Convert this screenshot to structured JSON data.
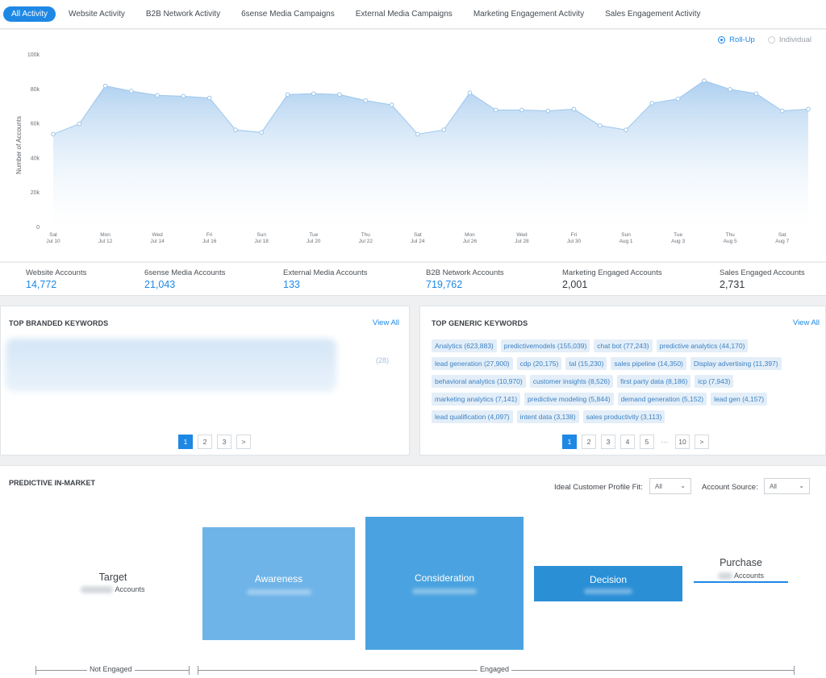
{
  "tabs": [
    {
      "label": "All Activity",
      "active": true
    },
    {
      "label": "Website Activity"
    },
    {
      "label": "B2B Network Activity"
    },
    {
      "label": "6sense Media Campaigns"
    },
    {
      "label": "External Media Campaigns"
    },
    {
      "label": "Marketing Engagement Activity"
    },
    {
      "label": "Sales Engagement Activity"
    }
  ],
  "view_toggle": {
    "rollup": {
      "label": "Roll-Up",
      "checked": true
    },
    "individual": {
      "label": "Individual",
      "checked": false
    }
  },
  "chart_data": {
    "type": "area",
    "ylabel": "Number of Accounts",
    "xlabel": "",
    "ylim": [
      0,
      100000
    ],
    "y_ticks": [
      "0",
      "20k",
      "40k",
      "60k",
      "80k",
      "100k"
    ],
    "x_tick_labels": [
      [
        "Sat",
        "Jul 10"
      ],
      [
        "Mon",
        "Jul 12"
      ],
      [
        "Wed",
        "Jul 14"
      ],
      [
        "Fri",
        "Jul 16"
      ],
      [
        "Sun",
        "Jul 18"
      ],
      [
        "Tue",
        "Jul 20"
      ],
      [
        "Thu",
        "Jul 22"
      ],
      [
        "Sat",
        "Jul 24"
      ],
      [
        "Mon",
        "Jul 26"
      ],
      [
        "Wed",
        "Jul 28"
      ],
      [
        "Fri",
        "Jul 30"
      ],
      [
        "Sun",
        "Aug 1"
      ],
      [
        "Tue",
        "Aug 3"
      ],
      [
        "Thu",
        "Aug 5"
      ],
      [
        "Sat",
        "Aug 7"
      ]
    ],
    "x": [
      "Jul 10",
      "Jul 11",
      "Jul 12",
      "Jul 13",
      "Jul 14",
      "Jul 15",
      "Jul 16",
      "Jul 17",
      "Jul 18",
      "Jul 19",
      "Jul 20",
      "Jul 21",
      "Jul 22",
      "Jul 23",
      "Jul 24",
      "Jul 25",
      "Jul 26",
      "Jul 27",
      "Jul 28",
      "Jul 29",
      "Jul 30",
      "Jul 31",
      "Aug 1",
      "Aug 2",
      "Aug 3",
      "Aug 4",
      "Aug 5",
      "Aug 6",
      "Aug 7",
      "Aug 8"
    ],
    "series": [
      {
        "values": [
          54000,
          60000,
          82000,
          79000,
          76500,
          76000,
          75000,
          56500,
          55000,
          77000,
          77500,
          77000,
          73500,
          71000,
          54000,
          56500,
          78000,
          68000,
          68000,
          67500,
          68500,
          59000,
          56500,
          72000,
          74500,
          85000,
          80000,
          77500,
          67500,
          68500
        ]
      }
    ],
    "grid": false,
    "color": "#1e88e5"
  },
  "stats": [
    {
      "label": "Website Accounts",
      "value": "14,772",
      "color": "blue"
    },
    {
      "label": "6sense Media Accounts",
      "value": "21,043",
      "color": "blue"
    },
    {
      "label": "External Media Accounts",
      "value": "133",
      "color": "blue"
    },
    {
      "label": "B2B Network Accounts",
      "value": "719,762",
      "color": "blue"
    },
    {
      "label": "Marketing Engaged Accounts",
      "value": "2,001",
      "color": "dark"
    },
    {
      "label": "Sales Engaged Accounts",
      "value": "2,731",
      "color": "dark"
    }
  ],
  "branded": {
    "title": "TOP BRANDED KEYWORDS",
    "view_all": "View All",
    "visible_count": "(28)",
    "pages": [
      "1",
      "2",
      "3"
    ],
    "next": ">"
  },
  "generic": {
    "title": "TOP GENERIC KEYWORDS",
    "view_all": "View All",
    "keywords": [
      "Analytics (623,883)",
      "predictivemodels (155,039)",
      "chat bot (77,243)",
      "predictive analytics (44,170)",
      "lead generation (27,900)",
      "cdp (20,175)",
      "tal (15,230)",
      "sales pipeline (14,350)",
      "Display advertising (11,397)",
      "behavioral analytics (10,970)",
      "customer insights (8,526)",
      "first party data (8,186)",
      "icp (7,943)",
      "marketing analytics (7,141)",
      "predictive modeling (5,844)",
      "demand generation (5,152)",
      "lead gen (4,157)",
      "lead qualification (4,097)",
      "intent data (3,138)",
      "sales productivity (3,113)"
    ],
    "pages": [
      "1",
      "2",
      "3",
      "4",
      "5",
      "···",
      "10"
    ],
    "next": ">"
  },
  "predictive": {
    "title": "PREDICTIVE IN-MARKET",
    "icp_label": "Ideal Customer Profile Fit:",
    "icp_value": "All",
    "source_label": "Account Source:",
    "source_value": "All",
    "target": {
      "name": "Target",
      "sub": "Accounts"
    },
    "awareness": "Awareness",
    "consideration": "Consideration",
    "decision": "Decision",
    "purchase": {
      "name": "Purchase",
      "sub": "Accounts"
    },
    "not_engaged": "Not Engaged",
    "engaged": "Engaged"
  }
}
